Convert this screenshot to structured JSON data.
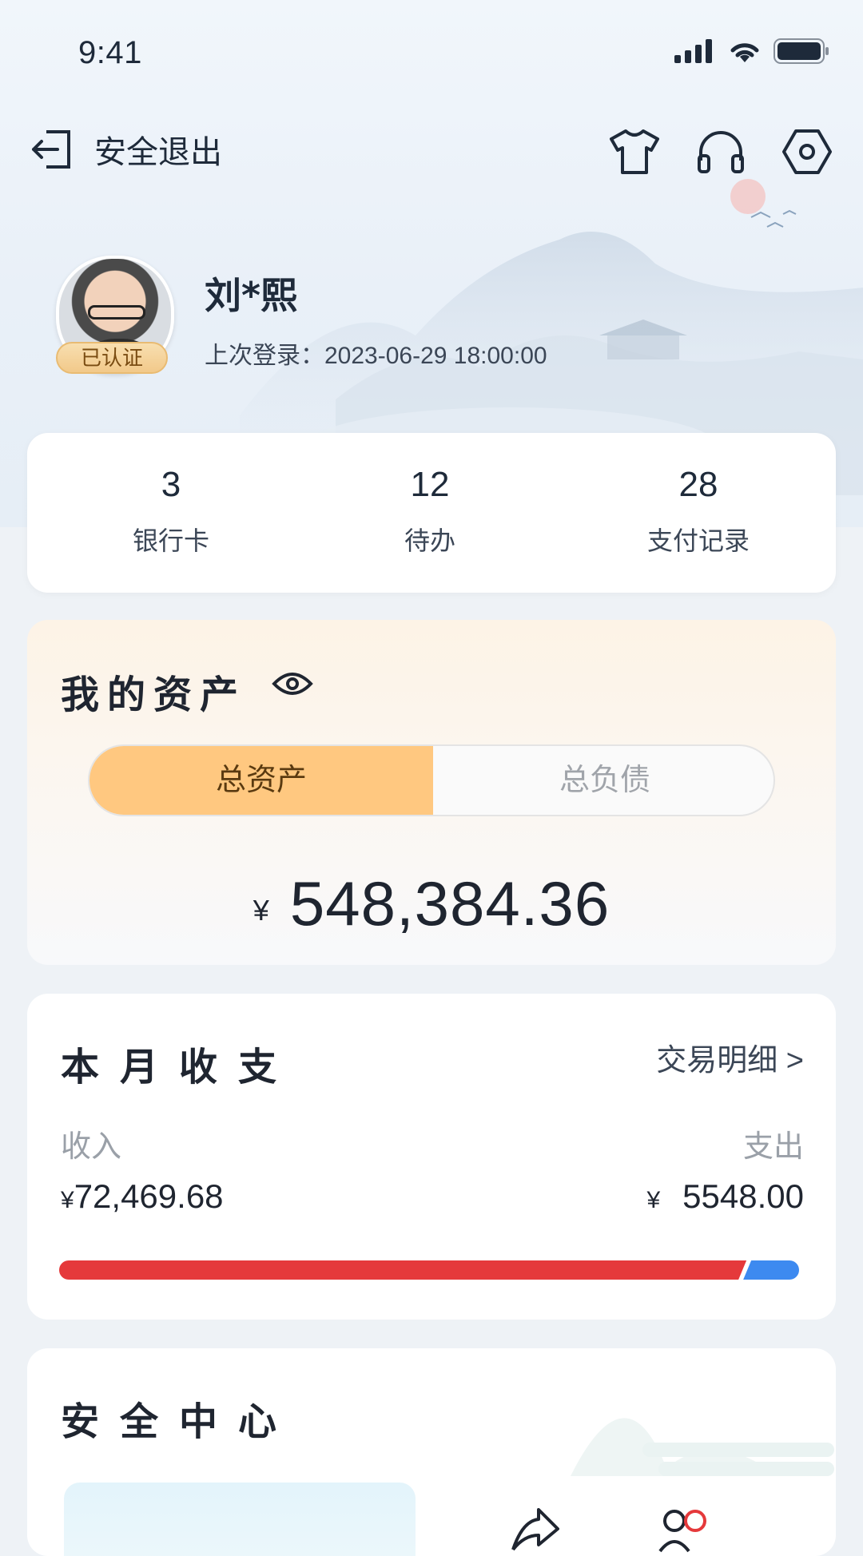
{
  "status_bar": {
    "time": "9:41",
    "icons": [
      "signal-icon",
      "wifi-icon",
      "battery-icon"
    ]
  },
  "nav": {
    "exit_label": "安全退出",
    "actions": [
      "tshirt-icon",
      "headphones-icon",
      "settings-icon"
    ]
  },
  "profile": {
    "name": "刘*熙",
    "verified_badge": "已认证",
    "last_login": "上次登录：2023-06-29 18:00:00"
  },
  "stats": [
    {
      "value": "3",
      "label": "银行卡"
    },
    {
      "value": "12",
      "label": "待办"
    },
    {
      "value": "28",
      "label": "支付记录"
    }
  ],
  "assets": {
    "title": "我的资产",
    "tabs": {
      "active": "总资产",
      "inactive": "总负债"
    },
    "currency": "¥",
    "amount": "548,384.36"
  },
  "monthly": {
    "title": "本月收支",
    "detail_link": "交易明细 >",
    "income_label": "收入",
    "expense_label": "支出",
    "income_value": "72,469.68",
    "income_currency": "¥",
    "expense_value": "5548.00",
    "expense_currency": "¥",
    "colors": {
      "income": "#e5393b",
      "expense": "#3d8af0"
    }
  },
  "security": {
    "title": "安全中心"
  }
}
